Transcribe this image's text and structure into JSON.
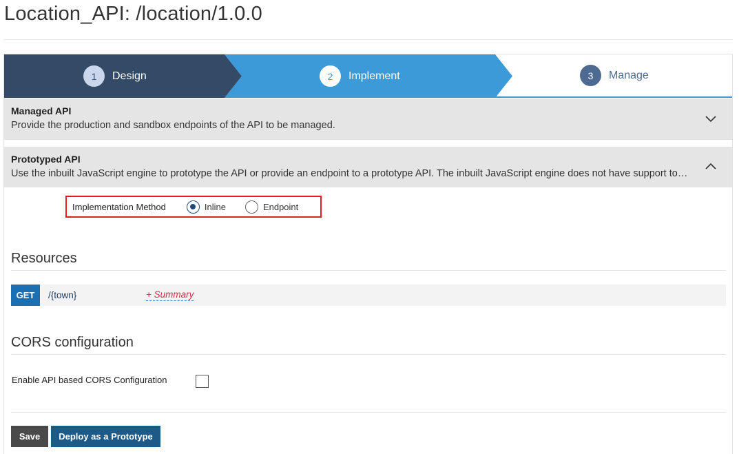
{
  "page": {
    "title": "Location_API: /location/1.0.0"
  },
  "wizard": {
    "steps": [
      {
        "number": "1",
        "label": "Design",
        "state": "completed"
      },
      {
        "number": "2",
        "label": "Implement",
        "state": "active"
      },
      {
        "number": "3",
        "label": "Manage",
        "state": "pending"
      }
    ]
  },
  "managed_api": {
    "title": "Managed API",
    "description": "Provide the production and sandbox endpoints of the API to be managed.",
    "expanded": false,
    "icon": "chevron-down-icon"
  },
  "prototyped_api": {
    "title": "Prototyped API",
    "description": "Use the inbuilt JavaScript engine to prototype the API or provide an endpoint to a prototype API. The inbuilt JavaScript engine does not have support to prototype SOAP APIs",
    "expanded": true,
    "icon": "chevron-up-icon",
    "implementation": {
      "label": "Implementation Method",
      "options": [
        {
          "label": "Inline",
          "selected": true
        },
        {
          "label": "Endpoint",
          "selected": false
        }
      ]
    }
  },
  "resources": {
    "title": "Resources",
    "items": [
      {
        "method": "GET",
        "path": "/{town}",
        "summary_link": "+ Summary"
      }
    ]
  },
  "cors": {
    "title": "CORS configuration",
    "enable_label": "Enable API based CORS Configuration",
    "enabled": false
  },
  "actions": {
    "save_label": "Save",
    "deploy_label": "Deploy as a Prototype"
  },
  "colors": {
    "design_step": "#344b67",
    "implement_step": "#3d9ad9",
    "manage_number": "#4d6b91",
    "highlight_box": "#e02020",
    "get_badge": "#1b6fb3",
    "save_button": "#4a4a4a",
    "deploy_button": "#1d5a88"
  }
}
